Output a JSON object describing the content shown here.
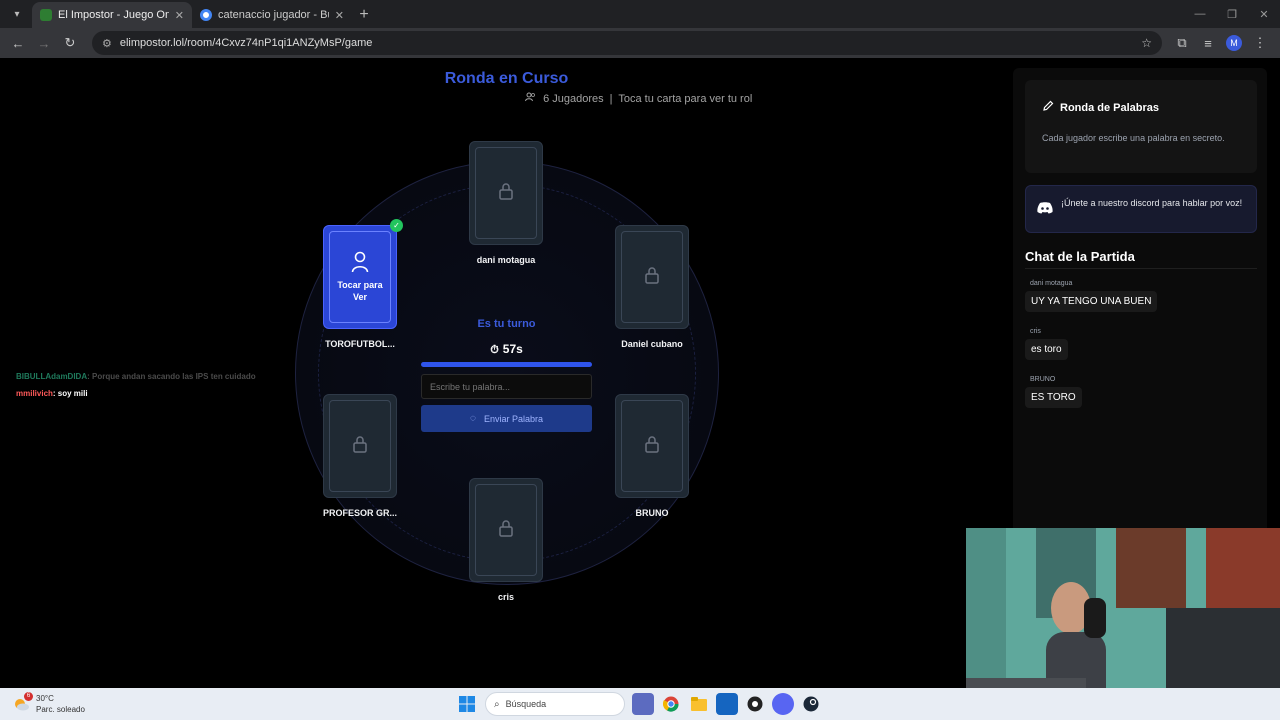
{
  "browser": {
    "tabs": [
      {
        "title": "El Impostor - Juego Online Gra",
        "active": true,
        "favicon_color": "#2e7d32"
      },
      {
        "title": "catenaccio jugador - Buscar c",
        "active": false,
        "favicon_color": "#4285f4"
      }
    ],
    "url": "elimpostor.lol/room/4Cxvz74nP1qi1ANZyMsP/game",
    "profile_initial": "M"
  },
  "game": {
    "title": "Ronda en Curso",
    "players_count": "6 Jugadores",
    "separator": "|",
    "instruction": "Toca tu carta para ver tu rol",
    "my_card_label": "Tocar para Ver",
    "players": [
      "dani motagua",
      "TOROFUTBOL...",
      "Daniel cubano",
      "PROFESOR GR...",
      "BRUNO",
      "cris"
    ],
    "turn_label": "Es tu turno",
    "timer": "57s",
    "timer_progress": 1.0,
    "word_placeholder": "Escribe tu palabra...",
    "send_label": "Enviar Palabra"
  },
  "sidebar": {
    "round_title": "Ronda de Palabras",
    "round_desc": "Cada jugador escribe una palabra en secreto.",
    "discord_text": "¡Únete a nuestro discord para hablar por voz!",
    "chat_title": "Chat de la Partida",
    "messages": [
      {
        "author": "dani motagua",
        "text": "UY YA TENGO UNA BUEN"
      },
      {
        "author": "cris",
        "text": "es toro"
      },
      {
        "author": "BRUNO",
        "text": "ES TORO"
      }
    ]
  },
  "stream_chat": [
    {
      "user": "BIBULLAdamDIDA",
      "text": ": Porque andan sacando las IPS ten cuidado",
      "user_color": "#1f7a5c",
      "text_color": "#4b4b4b"
    },
    {
      "user": "mmilivich",
      "text": ": soy mili",
      "user_color": "#ff5a5a",
      "text_color": "#ffffff"
    }
  ],
  "taskbar": {
    "temperature": "30°C",
    "weather": "Parc. soleado",
    "search_label": "Búsqueda",
    "weather_badge": "6"
  }
}
